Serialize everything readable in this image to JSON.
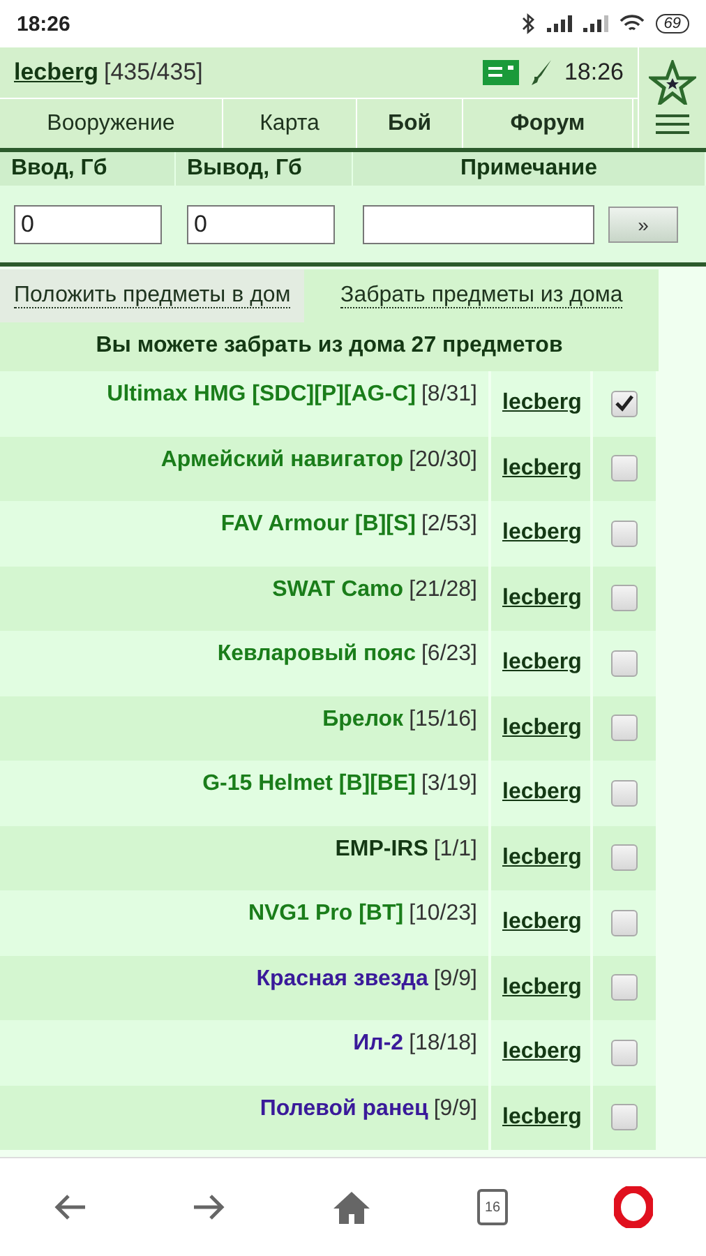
{
  "status_bar": {
    "time": "18:26",
    "battery": "69"
  },
  "header": {
    "user": "lecberg",
    "hp": "[435/435]",
    "time": "18:26"
  },
  "tabs": [
    {
      "label": "Вооружение",
      "bold": false
    },
    {
      "label": "Карта",
      "bold": false
    },
    {
      "label": "Бой",
      "bold": true
    },
    {
      "label": "Форум",
      "bold": true
    }
  ],
  "transfer": {
    "columns": [
      "Ввод, Гб",
      "Вывод, Гб",
      "Примечание"
    ],
    "input_value": "0",
    "output_value": "0",
    "submit": "»"
  },
  "mode_links": [
    {
      "label": "Положить предметы в дом",
      "selected": false
    },
    {
      "label": "Забрать предметы из дома",
      "selected": true
    }
  ],
  "heading": "Вы можете забрать из дома 27 предметов",
  "items": [
    {
      "name": "Ultimax HMG [SDC][P][AG-C]",
      "count": "[8/31]",
      "owner": "lecberg",
      "color": "#1a7d1a",
      "checked": true
    },
    {
      "name": "Армейский навигатор",
      "count": "[20/30]",
      "owner": "lecberg",
      "color": "#1a7d1a",
      "checked": false
    },
    {
      "name": "FAV Armour [B][S]",
      "count": "[2/53]",
      "owner": "lecberg",
      "color": "#1a7d1a",
      "checked": false
    },
    {
      "name": "SWAT Camo",
      "count": "[21/28]",
      "owner": "lecberg",
      "color": "#1a7d1a",
      "checked": false
    },
    {
      "name": "Кевларовый пояс",
      "count": "[6/23]",
      "owner": "lecberg",
      "color": "#1a7d1a",
      "checked": false
    },
    {
      "name": "Брелок",
      "count": "[15/16]",
      "owner": "lecberg",
      "color": "#1a7d1a",
      "checked": false
    },
    {
      "name": "G-15 Helmet [B][BE]",
      "count": "[3/19]",
      "owner": "lecberg",
      "color": "#1a7d1a",
      "checked": false
    },
    {
      "name": "EMP-IRS",
      "count": "[1/1]",
      "owner": "lecberg",
      "color": "#143814",
      "checked": false
    },
    {
      "name": "NVG1 Pro [BT]",
      "count": "[10/23]",
      "owner": "lecberg",
      "color": "#1a7d1a",
      "checked": false
    },
    {
      "name": "Красная звезда",
      "count": "[9/9]",
      "owner": "lecberg",
      "color": "#3a1a9a",
      "checked": false
    },
    {
      "name": "Ил-2",
      "count": "[18/18]",
      "owner": "lecberg",
      "color": "#3a1a9a",
      "checked": false
    },
    {
      "name": "Полевой ранец",
      "count": "[9/9]",
      "owner": "lecberg",
      "color": "#3a1a9a",
      "checked": false
    }
  ],
  "browser_bar": {
    "tab_count": "16"
  }
}
